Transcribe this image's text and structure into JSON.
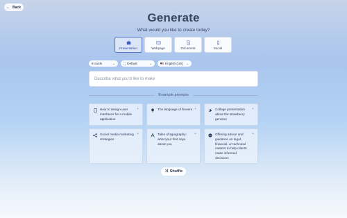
{
  "nav": {
    "back_label": "Back"
  },
  "header": {
    "title": "Generate",
    "subtitle": "What would you like to create today?"
  },
  "content_types": [
    {
      "label": "Presentation",
      "icon": "presentation-icon",
      "selected": true
    },
    {
      "label": "Webpage",
      "icon": "webpage-icon",
      "selected": false
    },
    {
      "label": "Document",
      "icon": "document-icon",
      "selected": false
    },
    {
      "label": "Social",
      "icon": "social-icon",
      "selected": false
    }
  ],
  "options": {
    "cards": "8 cards",
    "theme": "Default",
    "language": "English (US)"
  },
  "prompt": {
    "placeholder": "Describe what you'd like to make",
    "value": ""
  },
  "examples": {
    "label": "Example prompts",
    "items": [
      {
        "text": "How to design user interfaces for a mobile application",
        "icon": "phone-icon"
      },
      {
        "text": "The language of flowers",
        "icon": "flower-icon"
      },
      {
        "text": "College presentation about the strawberry genome",
        "icon": "dna-icon"
      },
      {
        "text": "Social media marketing strategies",
        "icon": "share-icon"
      },
      {
        "text": "Tales of typography: what your font says about you",
        "icon": "typography-icon"
      },
      {
        "text": "Offering advice and guidance on legal, financial, or technical matters to help clients make informed decisions",
        "icon": "scale-icon"
      }
    ]
  },
  "shuffle_label": "Shuffle",
  "colors": {
    "accent": "#5372c4",
    "text": "#2a3550"
  }
}
